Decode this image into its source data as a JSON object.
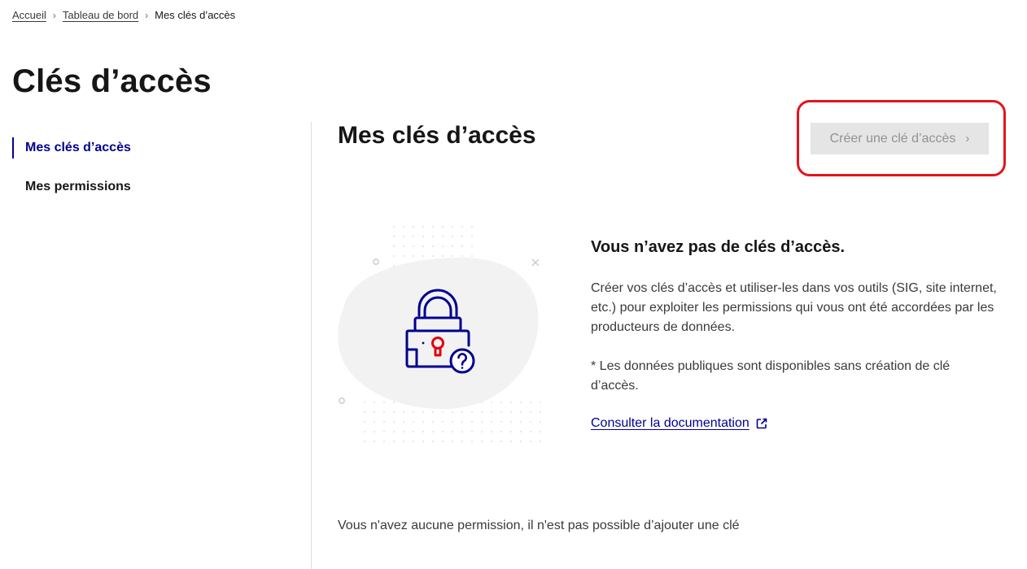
{
  "breadcrumb": {
    "items": [
      "Accueil",
      "Tableau de bord"
    ],
    "current": "Mes clés d’accès"
  },
  "page_title": "Clés d’accès",
  "sidebar": {
    "items": [
      {
        "label": "Mes clés d’accès",
        "active": true
      },
      {
        "label": "Mes permissions",
        "active": false
      }
    ]
  },
  "main": {
    "title": "Mes clés d’accès",
    "create_button": {
      "label": "Créer une clé d’accès",
      "disabled": true,
      "icon": "chevron-right-icon"
    },
    "empty_state": {
      "title": "Vous n’avez pas de clés d’accès.",
      "description": "Créer vos clés d’accès et utiliser-les dans vos outils (SIG, site internet, etc.) pour exploiter les permissions qui vous ont été accordées par les producteurs de données.",
      "note": "* Les données publiques sont disponibles sans création de clé d’accès.",
      "doc_link": {
        "label": "Consulter la documentation",
        "icon": "external-link-icon"
      },
      "illustration_icon": "padlock-question-icon"
    },
    "no_permission_text": "Vous n'avez aucune permission, il n'est pas possible d’ajouter une clé"
  },
  "colors": {
    "primary": "#000091",
    "text": "#161616",
    "muted_text": "#3a3a3a",
    "disabled_bg": "#e5e5e5",
    "disabled_text": "#929292",
    "highlight": "#e3141c",
    "accent_red": "#e1000f"
  }
}
